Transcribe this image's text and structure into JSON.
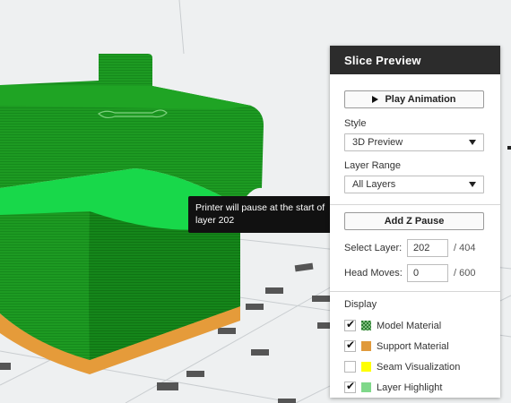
{
  "panel": {
    "title": "Slice Preview",
    "play_label": "Play Animation",
    "style_label": "Style",
    "style_value": "3D Preview",
    "layer_range_label": "Layer Range",
    "layer_range_value": "All Layers",
    "add_pause_label": "Add Z Pause",
    "select_layer_label": "Select Layer:",
    "select_layer_value": "202",
    "select_layer_total": "/ 404",
    "head_moves_label": "Head Moves:",
    "head_moves_value": "0",
    "head_moves_total": "/ 600",
    "display_label": "Display",
    "display_items": [
      {
        "label": "Model Material",
        "checked": true,
        "swatch": "#3b8f3b"
      },
      {
        "label": "Support Material",
        "checked": true,
        "swatch": "#e09a3c"
      },
      {
        "label": "Seam Visualization",
        "checked": false,
        "swatch": "#ffff00"
      },
      {
        "label": "Layer Highlight",
        "checked": true,
        "swatch": "#7fd88a"
      }
    ]
  },
  "tooltip": {
    "text_line1": "Printer will pause at the start of",
    "text_line2": "layer 202"
  },
  "colors": {
    "model": "#1a9e1f",
    "highlight": "#18d84a",
    "support": "#e59b3a",
    "bed": "#eef0f1",
    "panel_header": "#2c2c2c"
  }
}
